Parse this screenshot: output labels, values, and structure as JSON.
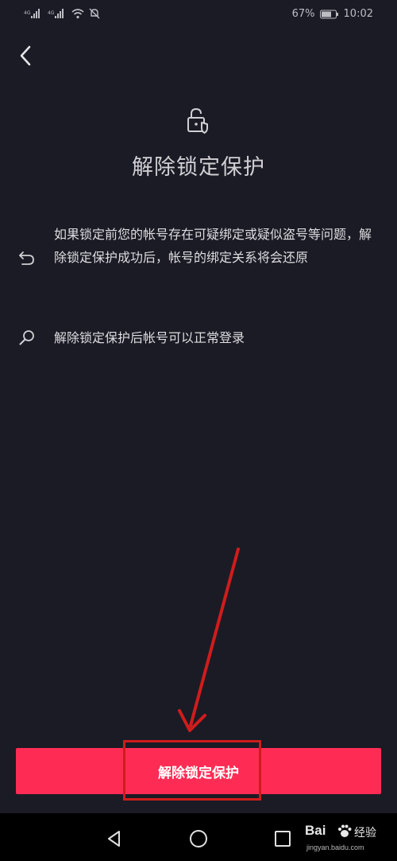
{
  "status_bar": {
    "battery_percent": "67%",
    "time": "10:02",
    "icons": [
      "signal-icon",
      "signal-icon",
      "wifi-icon",
      "mute-icon",
      "battery-icon"
    ]
  },
  "header": {
    "back_icon": "chevron-left-icon"
  },
  "page": {
    "icon": "unlock-shield-icon",
    "title": "解除锁定保护",
    "info_items": [
      {
        "icon": "undo-icon",
        "text": "如果锁定前您的帐号存在可疑绑定或疑似盗号等问题，解除锁定保护成功后，帐号的绑定关系将会还原"
      },
      {
        "icon": "search-icon",
        "text": "解除锁定保护后帐号可以正常登录"
      }
    ]
  },
  "action": {
    "button_label": "解除锁定保护"
  },
  "nav_bar": {
    "icons": [
      "triangle-back-icon",
      "circle-home-icon",
      "square-recent-icon"
    ]
  },
  "watermark": {
    "brand": "Bai",
    "brand_text": "经验",
    "url": "jingyan.baidu.com"
  },
  "colors": {
    "background": "#1b1b25",
    "button": "#fe2c55",
    "annotation": "#d01c1c"
  }
}
